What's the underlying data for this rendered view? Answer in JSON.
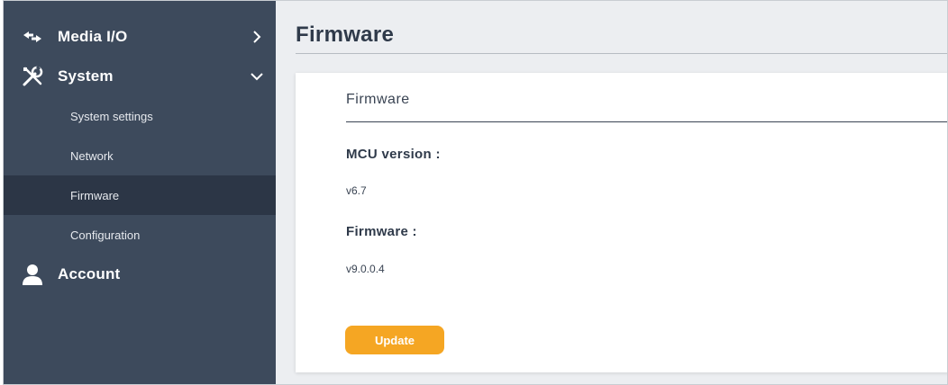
{
  "sidebar": {
    "media_io": {
      "label": "Media I/O",
      "icon": "arrows-icon",
      "chevron": "chevron-right-icon"
    },
    "system": {
      "label": "System",
      "icon": "tools-icon",
      "chevron": "chevron-down-icon",
      "items": [
        {
          "label": "System settings"
        },
        {
          "label": "Network"
        },
        {
          "label": "Firmware",
          "active": true
        },
        {
          "label": "Configuration"
        }
      ]
    },
    "account": {
      "label": "Account",
      "icon": "user-icon"
    }
  },
  "main": {
    "title": "Firmware",
    "card": {
      "title": "Firmware",
      "mcu_label": "MCU version :",
      "mcu_value": "v6.7",
      "firmware_label": "Firmware :",
      "firmware_value": "v9.0.0.4",
      "update_label": "Update"
    }
  },
  "colors": {
    "sidebar_bg": "#3d4a5c",
    "sidebar_active": "#2c3646",
    "accent": "#f5a623"
  }
}
